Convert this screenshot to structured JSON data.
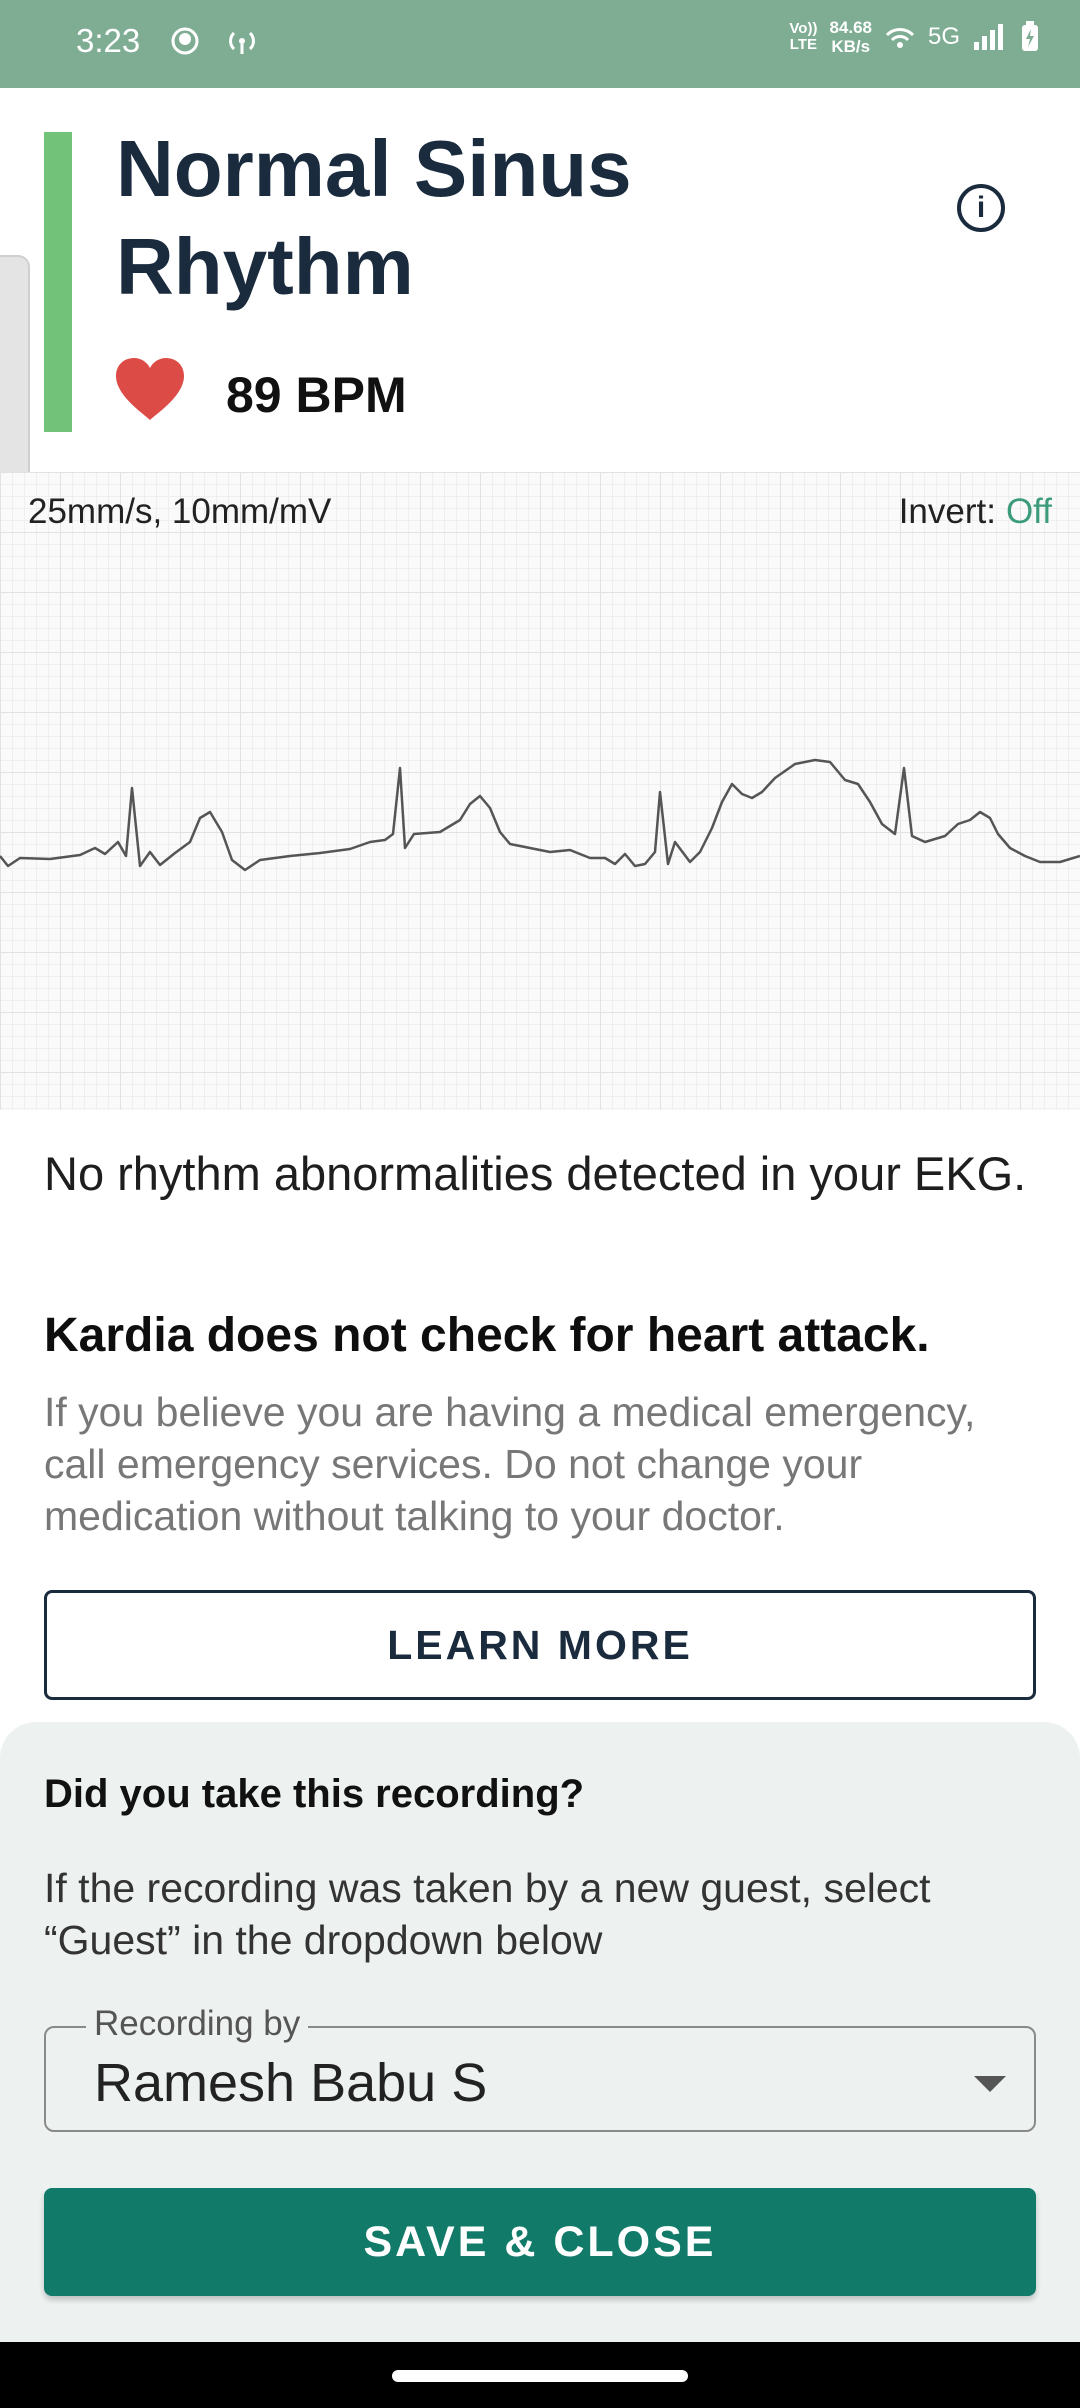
{
  "status_bar": {
    "time": "3:23",
    "net_speed_value": "84.68",
    "net_speed_unit": "KB/s",
    "volte_top": "Vo))",
    "volte_bottom": "LTE",
    "network": "5G",
    "icons": [
      "notification-icon",
      "hotspot-icon",
      "wifi-icon",
      "signal-icon",
      "battery-charging-icon"
    ]
  },
  "result": {
    "title": "Normal Sinus Rhythm",
    "status_color": "#73c27a",
    "heart_rate": "89 BPM"
  },
  "ekg": {
    "scale": "25mm/s, 10mm/mV",
    "invert_label": "Invert:",
    "invert_value": "Off",
    "trace_color": "#555555"
  },
  "analysis": {
    "summary": "No rhythm abnormalities detected in your EKG.",
    "warning_title": "Kardia does not check for heart attack.",
    "warning_text": "If you believe you are having a medical emergency, call emergency services. Do not change your medication without talking to your doctor.",
    "learn_more_label": "LEARN MORE"
  },
  "recording": {
    "question": "Did you take this recording?",
    "instruction": "If the recording was taken by a new guest, select “Guest” in the dropdown below",
    "dropdown_label": "Recording by",
    "dropdown_value": "Ramesh Babu S",
    "save_label": "SAVE & CLOSE"
  }
}
